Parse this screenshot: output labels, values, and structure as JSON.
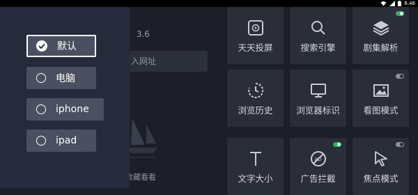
{
  "status_bar": {
    "time": "8:46"
  },
  "background": {
    "version_text": "： 3.6",
    "url_placeholder": "入网址",
    "bookmark_label": "收藏看看",
    "tiles": [
      {
        "label": "天天投屏",
        "icon": "cast-play-icon"
      },
      {
        "label": "搜索引擎",
        "icon": "search-icon"
      },
      {
        "label": "剧集解析",
        "icon": "layers-icon",
        "toggle": "on"
      },
      {
        "label": "浏览历史",
        "icon": "history-icon"
      },
      {
        "label": "浏览器标识",
        "icon": "monitor-icon"
      },
      {
        "label": "看图模式",
        "icon": "image-icon",
        "toggle": "off"
      },
      {
        "label": "文字大小",
        "icon": "text-size-icon"
      },
      {
        "label": "广告拦截",
        "icon": "ad-block-icon",
        "toggle": "on"
      },
      {
        "label": "焦点模式",
        "icon": "cursor-icon",
        "toggle": "off"
      }
    ]
  },
  "ua_menu": {
    "selected": "默认",
    "options": [
      {
        "label": "默认"
      },
      {
        "label": "电脑"
      },
      {
        "label": "iphone"
      },
      {
        "label": "ipad"
      }
    ]
  },
  "colors": {
    "panel": "#252b3b",
    "option_bg": "#4a5061",
    "toggle_on": "#2fae5c",
    "toggle_off": "#8c919c"
  }
}
